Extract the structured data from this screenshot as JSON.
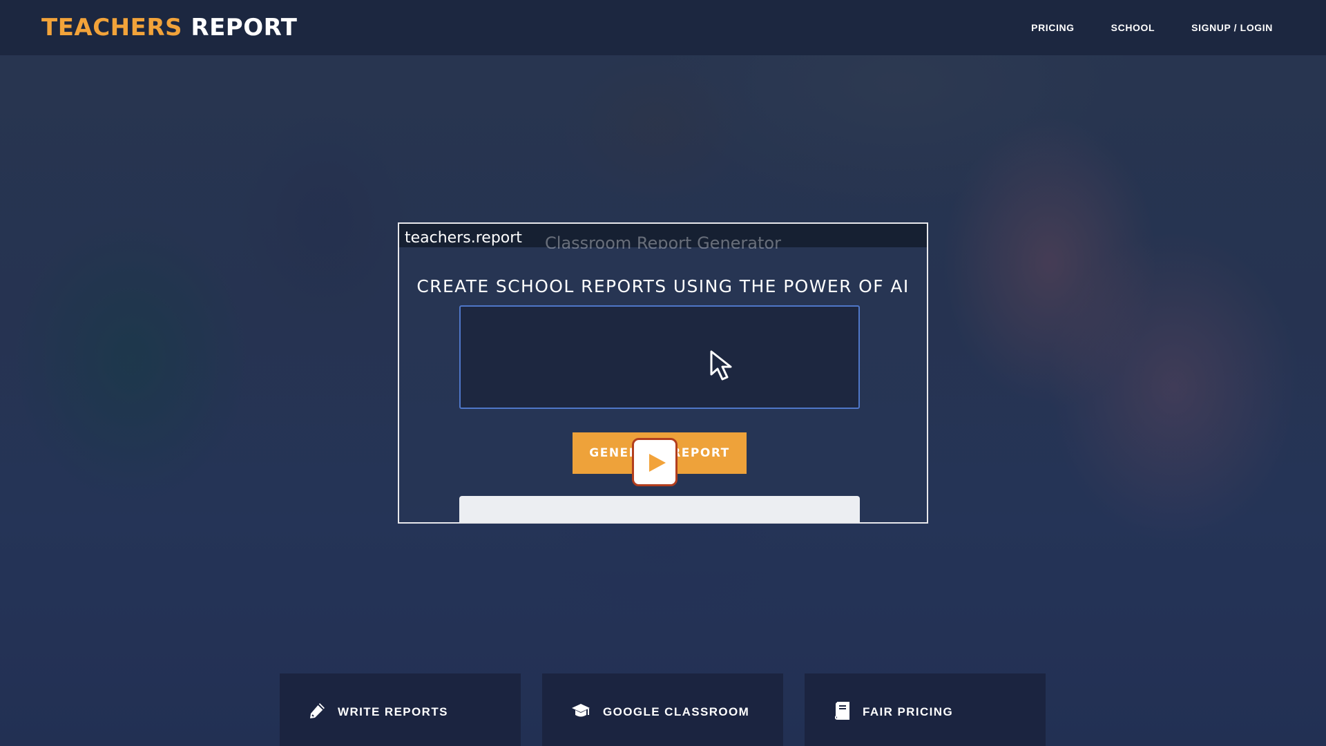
{
  "header": {
    "logo_accent": "TEACHERS",
    "logo_plain": "REPORT",
    "nav": [
      {
        "label": "PRICING"
      },
      {
        "label": "SCHOOL"
      },
      {
        "label": "SIGNUP / LOGIN"
      }
    ]
  },
  "video": {
    "site_label": "teachers.report",
    "ghost_title": "Classroom Report Generator",
    "headline": "CREATE SCHOOL REPORTS USING THE POWER OF AI",
    "generate_label": "GENERATE REPORT"
  },
  "features": [
    {
      "label": "WRITE REPORTS",
      "icon": "pencil-icon"
    },
    {
      "label": "GOOGLE CLASSROOM",
      "icon": "graduation-cap-icon"
    },
    {
      "label": "FAIR PRICING",
      "icon": "book-icon"
    }
  ],
  "colors": {
    "accent": "#f2a33a",
    "header_bg": "#1c2740",
    "card_bg": "#1b2440",
    "play_border": "#b23e1e"
  }
}
